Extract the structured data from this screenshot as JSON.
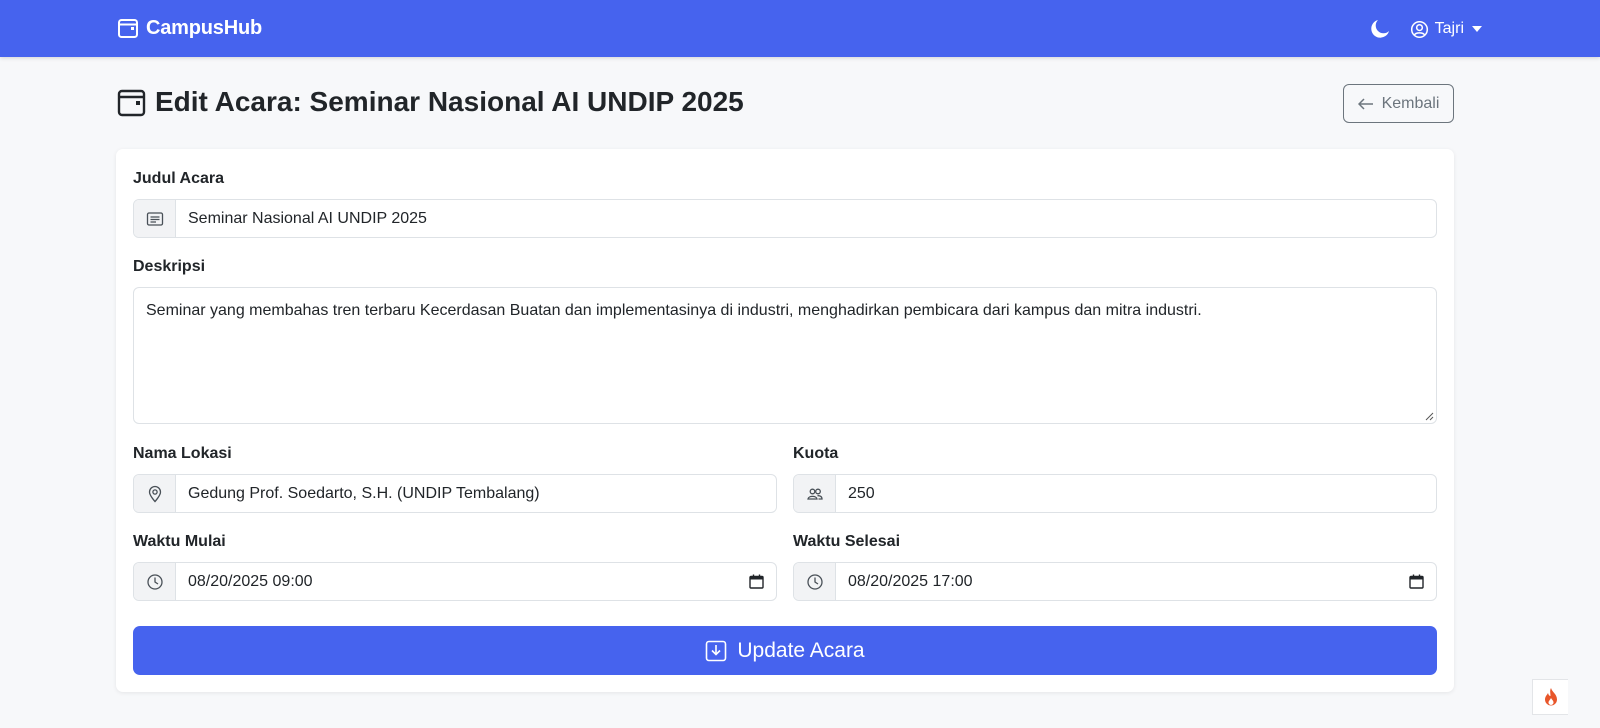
{
  "navbar": {
    "brand": "CampusHub",
    "user_name": "Tajri",
    "accent_color": "#4663ee"
  },
  "page": {
    "title": "Edit Acara: Seminar Nasional AI UNDIP 2025",
    "back_label": "Kembali"
  },
  "form": {
    "judul": {
      "label": "Judul Acara",
      "value": "Seminar Nasional AI UNDIP 2025",
      "icon": "card-text-icon"
    },
    "deskripsi": {
      "label": "Deskripsi",
      "value": "Seminar yang membahas tren terbaru Kecerdasan Buatan dan implementasinya di industri, menghadirkan pembicara dari kampus dan mitra industri."
    },
    "lokasi": {
      "label": "Nama Lokasi",
      "value": "Gedung Prof. Soedarto, S.H. (UNDIP Tembalang)",
      "icon": "geo-pin-icon"
    },
    "kuota": {
      "label": "Kuota",
      "value": "250",
      "icon": "people-icon"
    },
    "mulai": {
      "label": "Waktu Mulai",
      "value": "08/20/2025 09:00",
      "icon": "clock-icon"
    },
    "selesai": {
      "label": "Waktu Selesai",
      "value": "08/20/2025 17:00",
      "icon": "clock-icon"
    },
    "submit_label": "Update Acara"
  }
}
